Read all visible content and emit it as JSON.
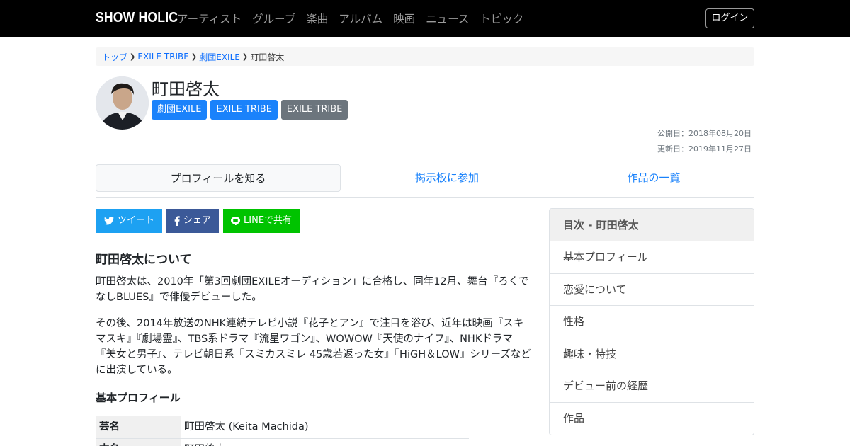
{
  "nav": {
    "brand": "SHOW HOLIC",
    "links": [
      "アーティスト",
      "グループ",
      "楽曲",
      "アルバム",
      "映画",
      "ニュース",
      "トピック"
    ],
    "login_label": "ログイン"
  },
  "breadcrumb": {
    "items": [
      "トップ",
      "EXILE TRIBE",
      "劇団EXILE"
    ],
    "current": "町田啓太"
  },
  "profile": {
    "name": "町田啓太",
    "tags": [
      {
        "label": "劇団EXILE",
        "color": "#1a82fb"
      },
      {
        "label": "EXILE TRIBE",
        "color": "#1a82fb"
      },
      {
        "label": "EXILE TRIBE",
        "color": "#6c757d"
      }
    ],
    "published": "公開日：2018年08月20日",
    "updated": "更新日：2019年11月27日"
  },
  "tabs": [
    "プロフィールを知る",
    "掲示板に参加",
    "作品の一覧"
  ],
  "share": {
    "tweet": "ツイート",
    "facebook": "シェア",
    "line": "LINEで共有"
  },
  "article": {
    "heading": "町田啓太について",
    "paragraphs": [
      "町田啓太は、2010年「第3回劇団EXILEオーディション」に合格し、同年12月、舞台『ろくでなしBLUES』で俳優デビューした。",
      "その後、2014年放送のNHK連続テレビ小説『花子とアン』で注目を浴び、近年は映画『スキマスキ』『劇場霊』、TBS系ドラマ『流星ワゴン』、WOWOW『天使のナイフ』、NHKドラマ『美女と男子』、テレビ朝日系『スミカスミレ 45歳若返った女』『HiGH＆LOW』シリーズなどに出演している。"
    ],
    "subheading": "基本プロフィール",
    "table": [
      {
        "label": "芸名",
        "value": "町田啓太 (Keita Machida)"
      },
      {
        "label": "本名",
        "value": "町田啓太"
      }
    ]
  },
  "toc": {
    "header": "目次 - 町田啓太",
    "items": [
      "基本プロフィール",
      "恋愛について",
      "性格",
      "趣味・特技",
      "デビュー前の経歴",
      "作品"
    ]
  }
}
